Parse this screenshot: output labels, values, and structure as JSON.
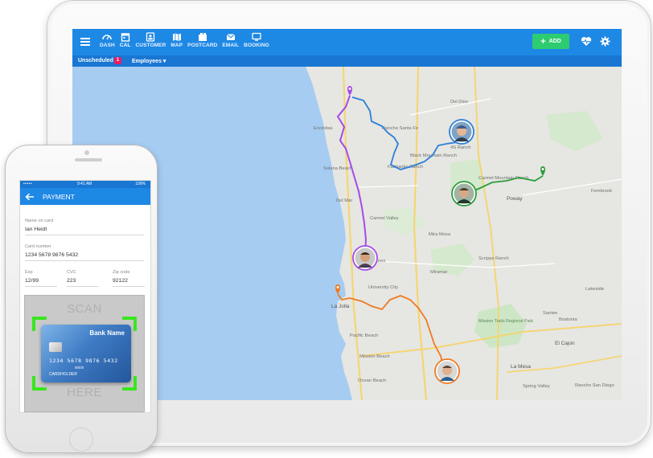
{
  "tablet": {
    "nav": [
      {
        "label": "DASH",
        "icon": "speedometer-icon"
      },
      {
        "label": "CAL",
        "icon": "calendar-icon"
      },
      {
        "label": "CUSTOMER",
        "icon": "contact-card-icon"
      },
      {
        "label": "MAP",
        "icon": "map-icon"
      },
      {
        "label": "POSTCARD",
        "icon": "postcard-icon"
      },
      {
        "label": "EMAIL",
        "icon": "envelope-icon"
      },
      {
        "label": "BOOKING",
        "icon": "monitor-icon"
      }
    ],
    "add_label": "ADD",
    "unscheduled_label": "Unscheduled",
    "unscheduled_count": "1",
    "employees_label": "Employees",
    "colors": {
      "primary": "#1e88e5",
      "subbar": "#1976d2",
      "add": "#2ecc71",
      "badge": "#e91e63"
    }
  },
  "map": {
    "places": [
      "Encinitas",
      "Solana Beach",
      "Del Mar",
      "Rancho Santa Fe",
      "Fairbanks Ranch",
      "Black Mountain Ranch",
      "4S Ranch",
      "Del Dios",
      "Carmel Mountain Ranch",
      "Poway",
      "Fembrook",
      "Carmel Valley",
      "Torrey Pines",
      "Mira Mesa",
      "Miramar",
      "Scripps Ranch",
      "La Jolla",
      "University City",
      "Pacific Beach",
      "Mission Beach",
      "Ocean Beach",
      "Lakeside",
      "Santee",
      "Mission Trails Regional Park",
      "Bostonia",
      "El Cajon",
      "La Mesa",
      "Spring Valley",
      "Rancho San Diego"
    ],
    "route_colors": {
      "purple": "#a64ae8",
      "blue": "#2b7fd8",
      "green": "#2e9e3a",
      "orange": "#ee7a23"
    }
  },
  "phone": {
    "status_time": "9:41 AM",
    "status_battery": "100%",
    "header_title": "PAYMENT",
    "name_label": "Name on card",
    "name_value": "Ian Heidt",
    "card_label": "Card number",
    "card_value": "1234 5678 9876 5432",
    "exp_label": "Exp",
    "exp_value": "12/99",
    "cvc_label": "CVC",
    "cvc_value": "223",
    "zip_label": "Zip code",
    "zip_value": "92122",
    "scan_top": "SCAN",
    "scan_bottom": "HERE",
    "card_bank": "Bank Name",
    "card_number": "1234 5678 9876 5432",
    "card_expiry": "00/00",
    "card_holder": "CARDHOLDER"
  }
}
